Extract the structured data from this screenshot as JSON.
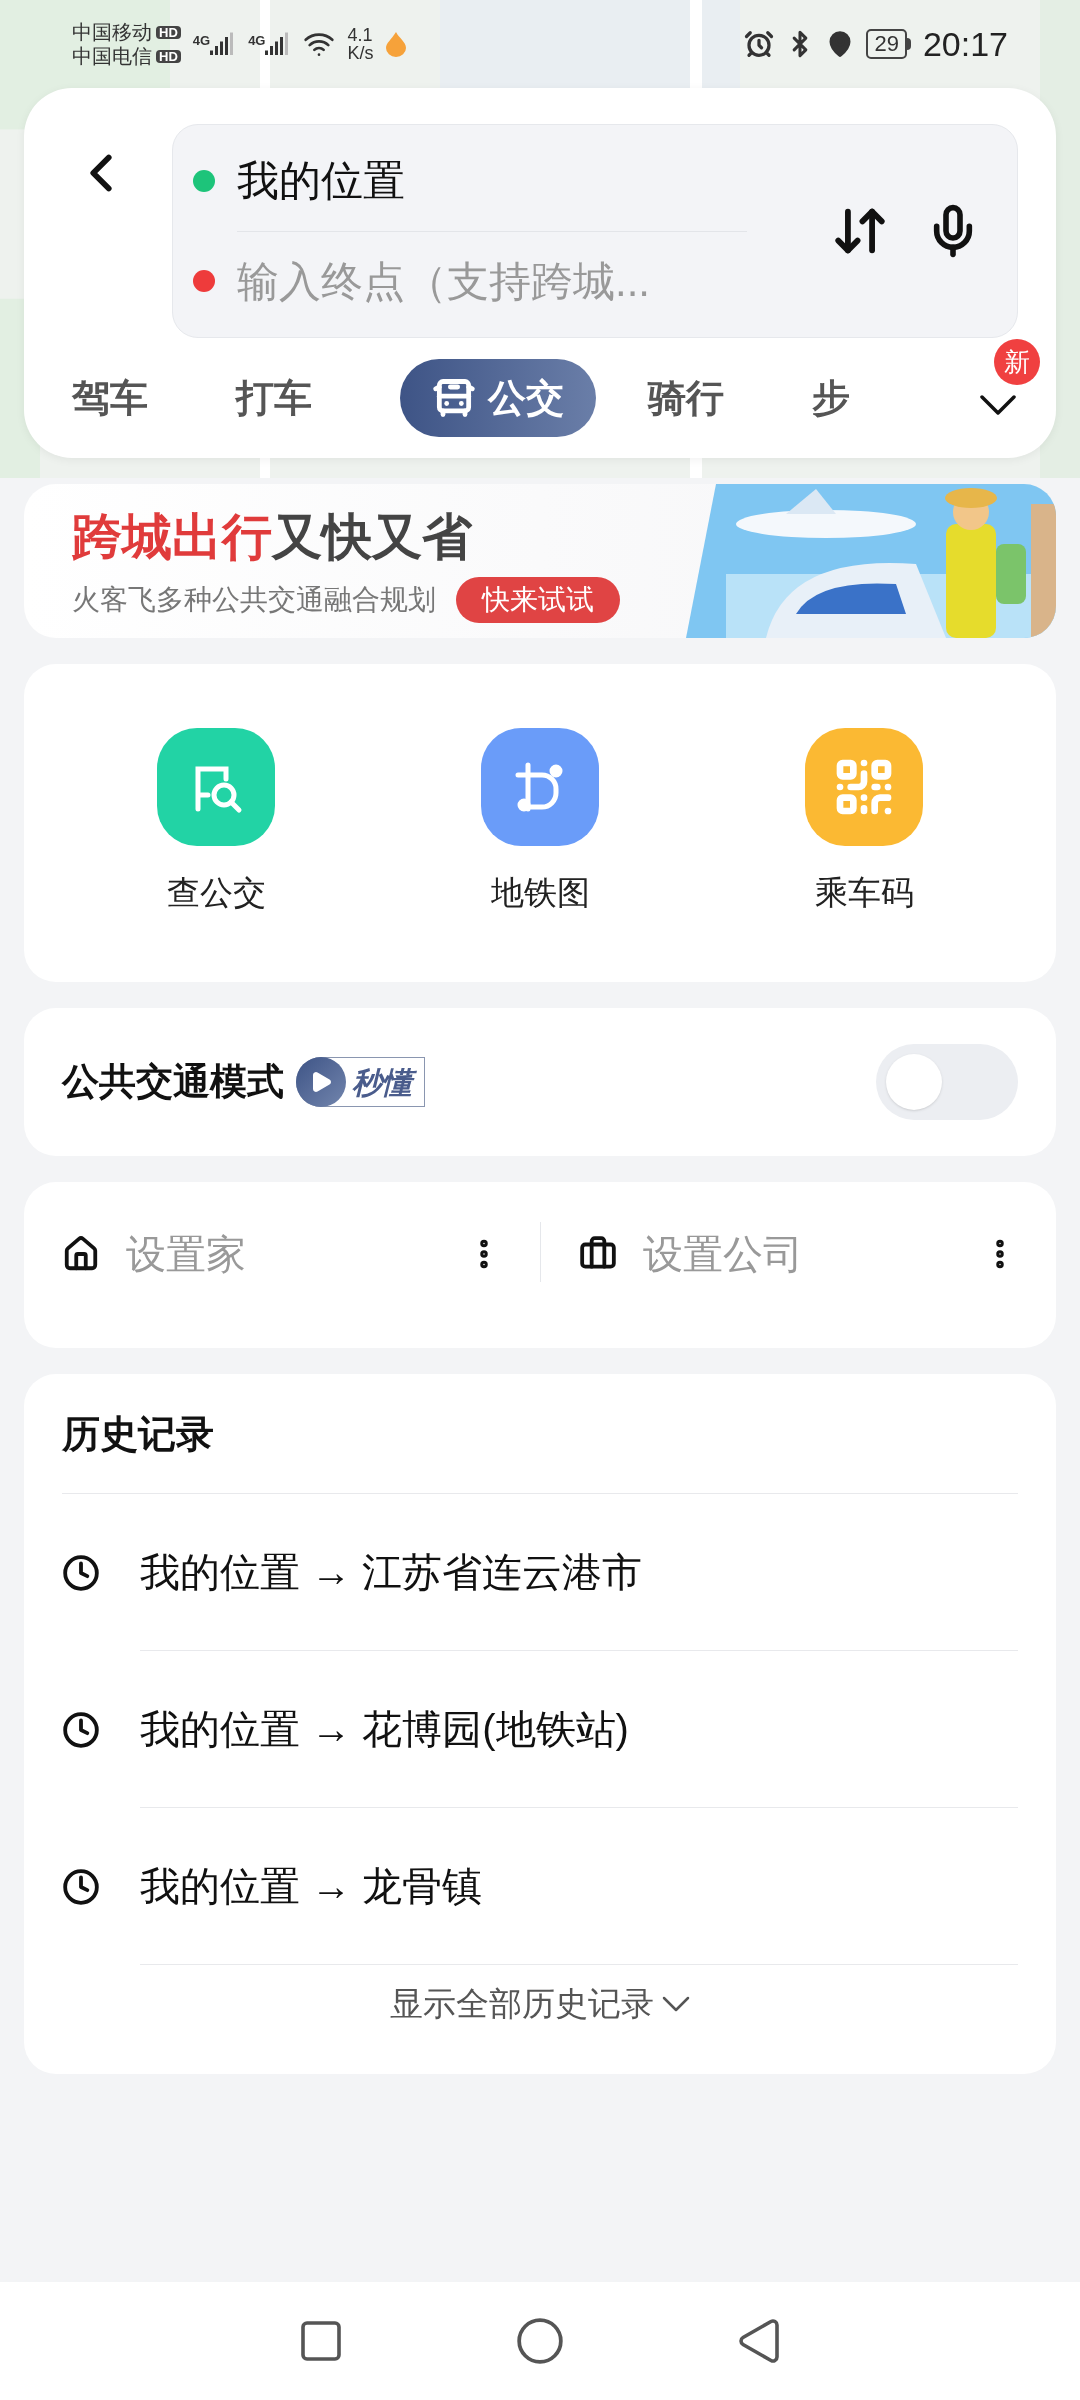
{
  "status_bar": {
    "carriers": [
      {
        "name": "中国移动",
        "badge": "HD"
      },
      {
        "name": "中国电信",
        "badge": "HD"
      }
    ],
    "networks": [
      "4G",
      "4G"
    ],
    "speed": "4.1",
    "speed_unit": "K/s",
    "battery": "29",
    "time": "20:17"
  },
  "route": {
    "origin": "我的位置",
    "destination_placeholder": "输入终点（支持跨城..."
  },
  "tabs": [
    {
      "label": "驾车",
      "selected": false
    },
    {
      "label": "打车",
      "selected": false
    },
    {
      "label": "公交",
      "selected": true
    },
    {
      "label": "骑行",
      "selected": false
    },
    {
      "label": "步",
      "selected": false
    }
  ],
  "more_badge": "新",
  "banner": {
    "title_highlight": "跨城出行",
    "title_rest": "又快又省",
    "subtitle": "火客飞多种公共交通融合规划",
    "button": "快来试试"
  },
  "shortcuts": [
    {
      "kind": "bus",
      "label": "查公交",
      "color": "#22d3a5"
    },
    {
      "kind": "metro",
      "label": "地铁图",
      "color": "#6a9cf9"
    },
    {
      "kind": "qr",
      "label": "乘车码",
      "color": "#fbb933"
    }
  ],
  "transit_mode": {
    "title": "公共交通模式",
    "video_badge": "秒懂",
    "on": false
  },
  "places": [
    {
      "kind": "home",
      "label": "设置家"
    },
    {
      "kind": "work",
      "label": "设置公司"
    }
  ],
  "history": {
    "title": "历史记录",
    "items": [
      "我的位置 → 江苏省连云港市",
      "我的位置 → 花博园(地铁站)",
      "我的位置 → 龙骨镇"
    ],
    "show_all": "显示全部历史记录"
  }
}
